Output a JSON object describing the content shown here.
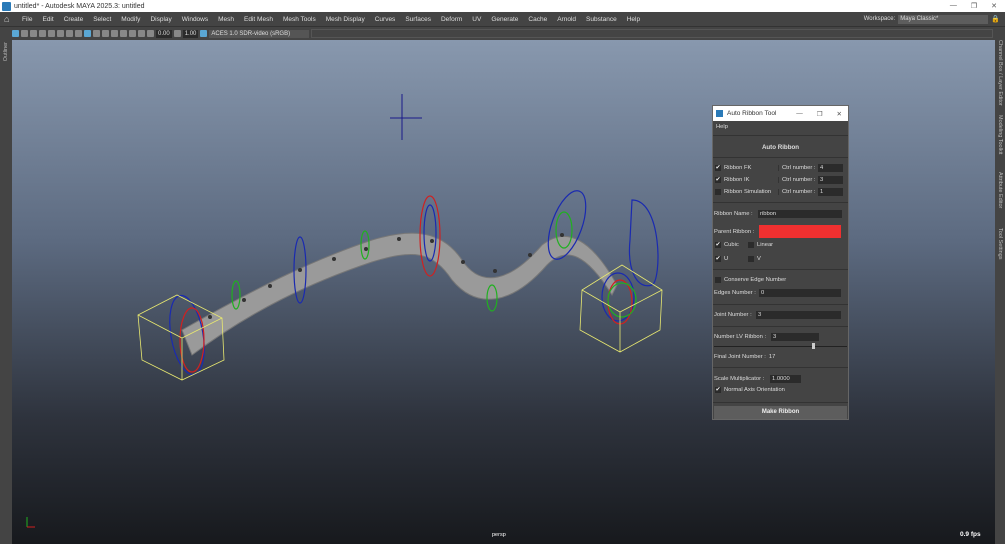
{
  "window": {
    "title": "untitled* - Autodesk MAYA 2025.3: untitled",
    "min": "—",
    "max": "❐",
    "close": "✕"
  },
  "menu": [
    "File",
    "Edit",
    "Create",
    "Select",
    "Modify",
    "Display",
    "Windows",
    "Mesh",
    "Edit Mesh",
    "Mesh Tools",
    "Mesh Display",
    "Curves",
    "Surfaces",
    "Deform",
    "UV",
    "Generate",
    "Cache",
    "Arnold",
    "Substance",
    "Help"
  ],
  "workspace": {
    "label": "Workspace:",
    "value": "Maya Classic*"
  },
  "toolbar": {
    "field1": "0.00",
    "field2": "1.00",
    "colorspace": "ACES 1.0 SDR-video (sRGB)"
  },
  "side": {
    "left": "Outliner",
    "right": [
      "Channel Box / Layer Editor",
      "Modeling Toolkit",
      "Attribute Editor",
      "Tool Settings"
    ]
  },
  "viewport": {
    "camera": "persp",
    "fps": "0.9 fps"
  },
  "tool": {
    "title": "Auto Ribbon Tool",
    "menu_help": "Help",
    "header": "Auto Ribbon",
    "rows": [
      {
        "label": "Ribbon FK",
        "checked": "✔",
        "ctrl_label": "Ctrl number :",
        "ctrl": "4"
      },
      {
        "label": "Ribbon IK",
        "checked": "✔",
        "ctrl_label": "Ctrl number :",
        "ctrl": "3"
      },
      {
        "label": "Ribbon Simulation",
        "checked": "",
        "ctrl_label": "Ctrl number :",
        "ctrl": "1"
      }
    ],
    "ribbon_name_label": "Ribbon Name :",
    "ribbon_name": "ribbon",
    "parent_label": "Parent Ribbon :",
    "parent_color": "#f03030",
    "cubic": "Cubic",
    "linear": "Linear",
    "u": "U",
    "v": "V",
    "check": "✔",
    "conserve": "Conserve Edge Number",
    "edges_label": "Edges Number :",
    "edges": "0",
    "joint_label": "Joint Number :",
    "joint": "3",
    "lv_label": "Number LV Ribbon :",
    "lv": "3",
    "lv_slider": 0.75,
    "final_label": "Final Joint Number :",
    "final": "17",
    "scale_label": "Scale Multiplicator :",
    "scale": "1.0000",
    "normal": "Normal Axis Orientation",
    "make": "Make Ribbon"
  }
}
